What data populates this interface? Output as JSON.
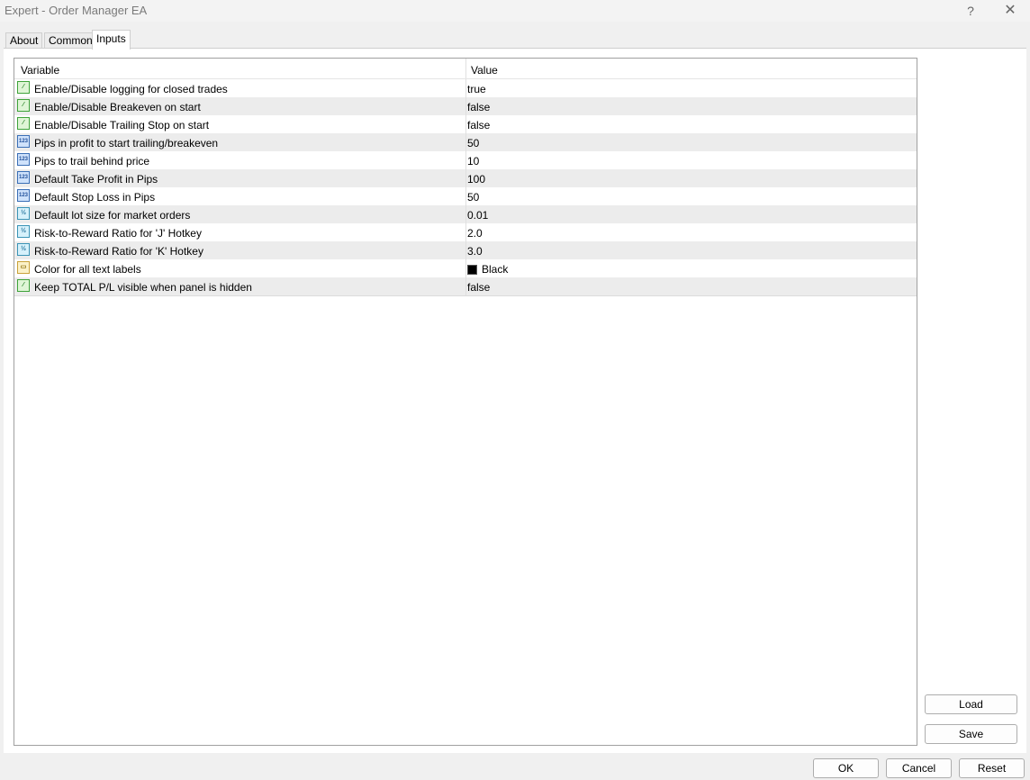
{
  "window": {
    "title": "Expert - Order Manager EA",
    "help_label": "?",
    "close_label": "✕"
  },
  "tabs": [
    {
      "label": "About",
      "active": false
    },
    {
      "label": "Common",
      "active": false
    },
    {
      "label": "Inputs",
      "active": true
    }
  ],
  "grid": {
    "columns": {
      "variable": "Variable",
      "value": "Value"
    },
    "rows": [
      {
        "icon": "bool-icon",
        "icon_text": "⁄",
        "name": "Enable/Disable logging for closed trades",
        "value": "true"
      },
      {
        "icon": "bool-icon",
        "icon_text": "⁄",
        "name": "Enable/Disable Breakeven on start",
        "value": "false"
      },
      {
        "icon": "bool-icon",
        "icon_text": "⁄",
        "name": "Enable/Disable Trailing Stop on start",
        "value": "false"
      },
      {
        "icon": "int-icon",
        "icon_text": "123",
        "name": "Pips in profit to start trailing/breakeven",
        "value": "50"
      },
      {
        "icon": "int-icon",
        "icon_text": "123",
        "name": "Pips to trail behind price",
        "value": "10"
      },
      {
        "icon": "int-icon",
        "icon_text": "123",
        "name": "Default Take Profit in Pips",
        "value": "100"
      },
      {
        "icon": "int-icon",
        "icon_text": "123",
        "name": "Default Stop Loss in Pips",
        "value": "50"
      },
      {
        "icon": "double-icon",
        "icon_text": "½",
        "name": "Default lot size for market orders",
        "value": "0.01"
      },
      {
        "icon": "double-icon",
        "icon_text": "½",
        "name": "Risk-to-Reward Ratio for 'J' Hotkey",
        "value": "2.0"
      },
      {
        "icon": "double-icon",
        "icon_text": "½",
        "name": "Risk-to-Reward Ratio for 'K' Hotkey",
        "value": "3.0"
      },
      {
        "icon": "color-icon",
        "icon_text": "▭",
        "name": "Color for all text labels",
        "value": "Black",
        "swatch": "#000000"
      },
      {
        "icon": "bool-icon",
        "icon_text": "⁄",
        "name": "Keep TOTAL P/L visible when panel is hidden",
        "value": "false"
      }
    ]
  },
  "side_buttons": {
    "load": "Load",
    "save": "Save"
  },
  "footer_buttons": {
    "ok": "OK",
    "cancel": "Cancel",
    "reset": "Reset"
  }
}
